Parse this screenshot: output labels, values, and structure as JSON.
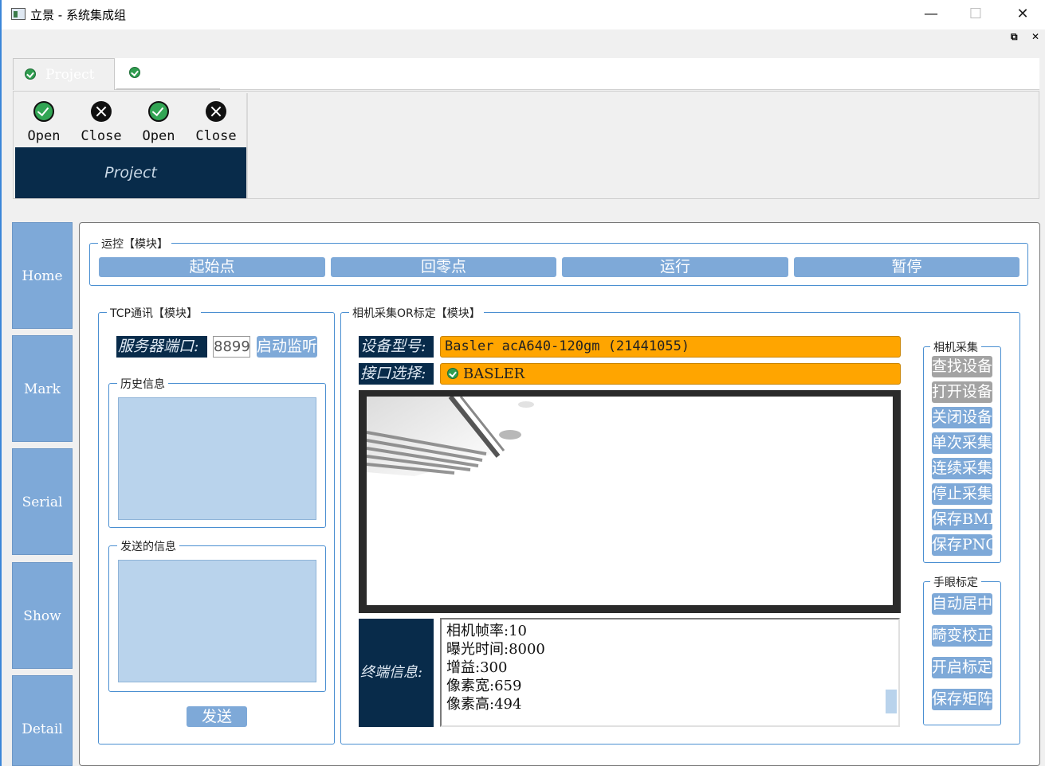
{
  "window": {
    "title": "立景 - 系统集成组",
    "minimize": "—",
    "maximize": "☐",
    "close": "✕",
    "mdi_restore": "⧉",
    "mdi_close": "✕"
  },
  "ribbon": {
    "tabs": [
      {
        "label": "Project",
        "icon": "check-icon"
      },
      {
        "label": "",
        "icon": "check-icon"
      }
    ],
    "buttons": [
      {
        "label": "Open",
        "icon": "check-circle-icon"
      },
      {
        "label": "Close",
        "icon": "x-circle-icon"
      },
      {
        "label": "Open",
        "icon": "check-circle-icon"
      },
      {
        "label": "Close",
        "icon": "x-circle-icon"
      }
    ],
    "group_label": "Project"
  },
  "nav": {
    "items": [
      "Home",
      "Mark",
      "Serial",
      "Show",
      "Detail"
    ]
  },
  "motion": {
    "title": "运控【模块】",
    "buttons": [
      "起始点",
      "回零点",
      "运行",
      "暂停"
    ]
  },
  "tcp": {
    "title": "TCP通讯【模块】",
    "port_label": "服务器端口:",
    "port_value": "8899",
    "listen_button": "启动监听",
    "history_title": "历史信息",
    "send_title": "发送的信息",
    "send_button": "发送"
  },
  "camera": {
    "title": "相机采集OR标定【模块】",
    "device_label": "设备型号:",
    "device_value": "Basler acA640-120gm (21441055)",
    "interface_label": "接口选择:",
    "interface_value": "BASLER",
    "terminal_label": "终端信息:",
    "terminal_lines": [
      "相机帧率:10",
      "曝光时间:8000",
      "增益:300",
      "像素宽:659",
      "像素高:494"
    ],
    "capture_group_title": "相机采集",
    "capture_buttons": [
      "查找设备",
      "打开设备",
      "关闭设备",
      "单次采集",
      "连续采集",
      "停止采集",
      "保存BMP",
      "保存PNG"
    ],
    "calib_group_title": "手眼标定",
    "calib_buttons": [
      "自动居中",
      "畸变校正",
      "开启标定",
      "保存矩阵"
    ]
  },
  "colors": {
    "accent": "#7ea9d8",
    "dark_label": "#082b4a",
    "orange": "#ffa500",
    "pale_blue": "#b9d3ec"
  }
}
